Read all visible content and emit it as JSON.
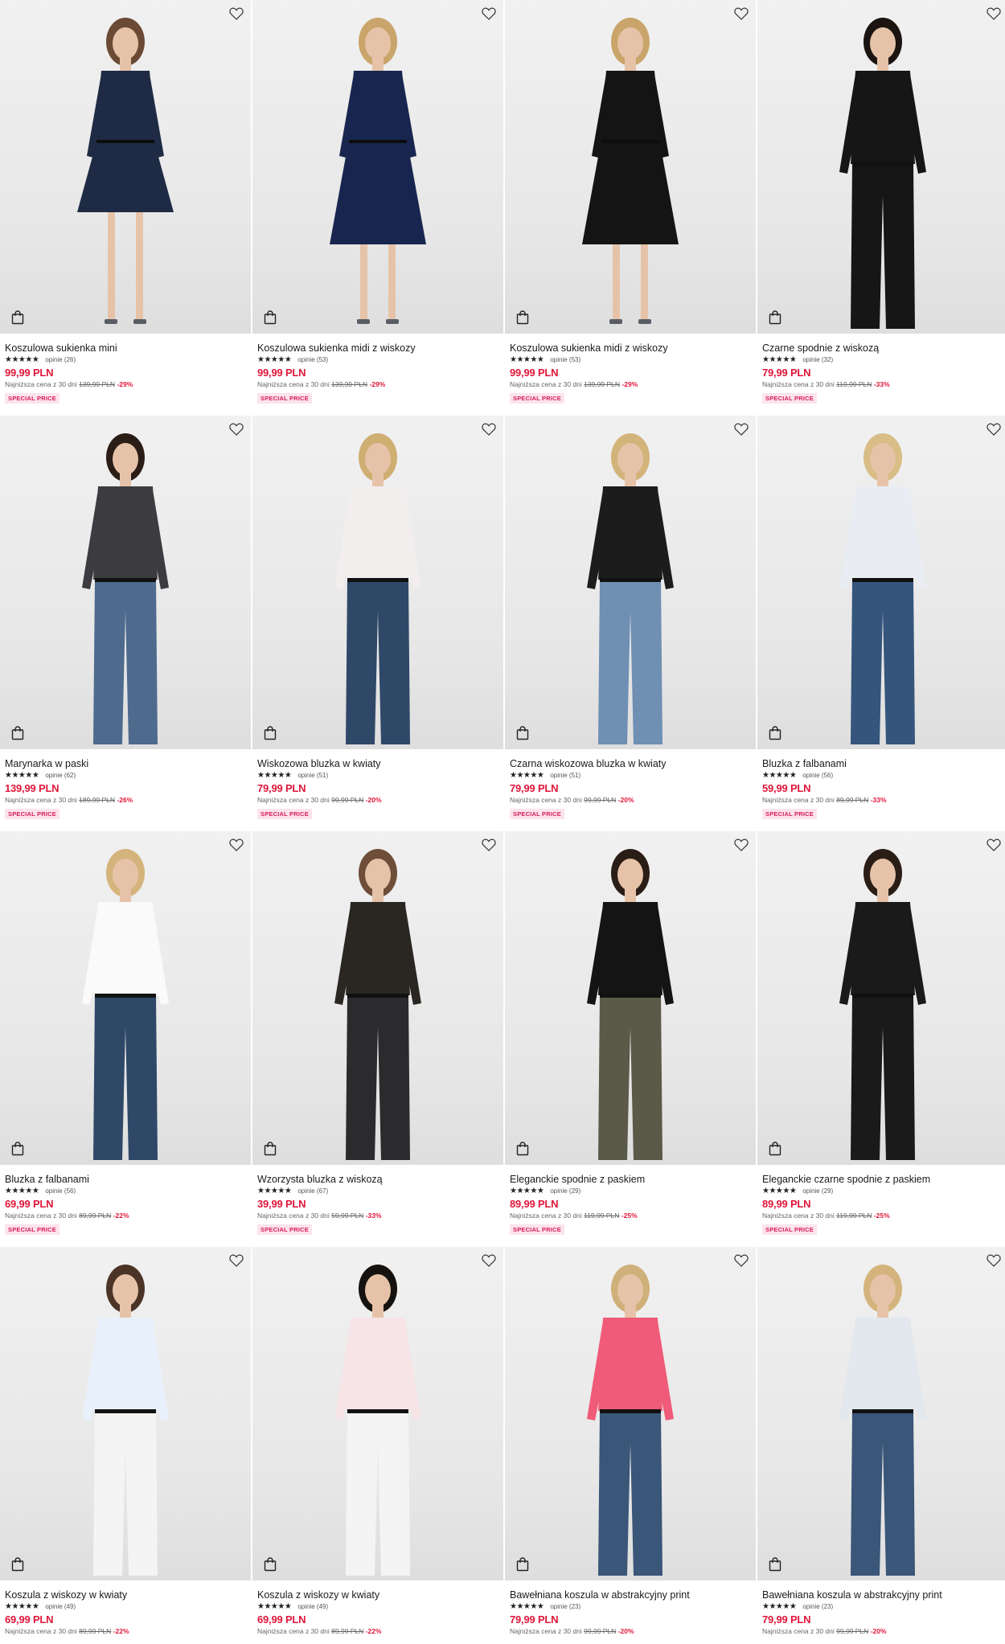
{
  "colors": {
    "price": "#e0163a",
    "badge_text": "#d81b60",
    "badge_bg": "#fce4ec"
  },
  "products": [
    {
      "name": "Koszulowa sukienka mini",
      "reviews": "opinie (26)",
      "price": "99,99 PLN",
      "lowest_label": "Najniższa cena z 30 dni",
      "old_price": "139,99 PLN",
      "discount": "-29%",
      "badge": "SPECIAL PRICE",
      "top": "#1f2b44",
      "bottom": "#1f2b44",
      "length": "mini",
      "hair": "#6b4a35"
    },
    {
      "name": "Koszulowa sukienka midi z wiskozy",
      "reviews": "opinie (53)",
      "price": "99,99 PLN",
      "lowest_label": "Najniższa cena z 30 dni",
      "old_price": "139,99 PLN",
      "discount": "-29%",
      "badge": "SPECIAL PRICE",
      "top": "#18264f",
      "bottom": "#18264f",
      "length": "midi",
      "hair": "#c9a56b"
    },
    {
      "name": "Koszulowa sukienka midi z wiskozy",
      "reviews": "opinie (53)",
      "price": "99,99 PLN",
      "lowest_label": "Najniższa cena z 30 dni",
      "old_price": "139,99 PLN",
      "discount": "-29%",
      "badge": "SPECIAL PRICE",
      "top": "#141414",
      "bottom": "#141414",
      "length": "midi",
      "hair": "#c9a56b"
    },
    {
      "name": "Czarne spodnie z wiskozą",
      "reviews": "opinie (32)",
      "price": "79,99 PLN",
      "lowest_label": "Najniższa cena z 30 dni",
      "old_price": "119,99 PLN",
      "discount": "-33%",
      "badge": "SPECIAL PRICE",
      "top": "#161616",
      "bottom": "#161616",
      "length": "pants",
      "hair": "#1b1410"
    },
    {
      "name": "Marynarka w paski",
      "reviews": "opinie (62)",
      "price": "139,99 PLN",
      "lowest_label": "Najniższa cena z 30 dni",
      "old_price": "189,99 PLN",
      "discount": "-26%",
      "badge": "SPECIAL PRICE",
      "top": "#3b3b40",
      "bottom": "#4e6b8e",
      "length": "pants",
      "hair": "#2a1d16"
    },
    {
      "name": "Wiskozowa bluzka w kwiaty",
      "reviews": "opinie (51)",
      "price": "79,99 PLN",
      "lowest_label": "Najniższa cena z 30 dni",
      "old_price": "99,99 PLN",
      "discount": "-20%",
      "badge": "SPECIAL PRICE",
      "top": "#f3eeee",
      "bottom": "#2f4868",
      "length": "pants",
      "hair": "#cfae72"
    },
    {
      "name": "Czarna wiskozowa bluzka w kwiaty",
      "reviews": "opinie (51)",
      "price": "79,99 PLN",
      "lowest_label": "Najniższa cena z 30 dni",
      "old_price": "99,99 PLN",
      "discount": "-20%",
      "badge": "SPECIAL PRICE",
      "top": "#1c1c1c",
      "bottom": "#6f8fb3",
      "length": "pants",
      "hair": "#d2b37a"
    },
    {
      "name": "Bluzka z falbanami",
      "reviews": "opinie (56)",
      "price": "59,99 PLN",
      "lowest_label": "Najniższa cena z 30 dni",
      "old_price": "89,99 PLN",
      "discount": "-33%",
      "badge": "SPECIAL PRICE",
      "top": "#e9edf3",
      "bottom": "#35557c",
      "length": "pants",
      "hair": "#d8bd86"
    },
    {
      "name": "Bluzka z falbanami",
      "reviews": "opinie (56)",
      "price": "69,99 PLN",
      "lowest_label": "Najniższa cena z 30 dni",
      "old_price": "89,99 PLN",
      "discount": "-22%",
      "badge": "SPECIAL PRICE",
      "top": "#fafafa",
      "bottom": "#2f4868",
      "length": "pants",
      "hair": "#d4b47c"
    },
    {
      "name": "Wzorzysta bluzka z wiskozą",
      "reviews": "opinie (67)",
      "price": "39,99 PLN",
      "lowest_label": "Najniższa cena z 30 dni",
      "old_price": "59,99 PLN",
      "discount": "-33%",
      "badge": "SPECIAL PRICE",
      "top": "#2a2722",
      "bottom": "#2b2b2e",
      "length": "pants",
      "hair": "#6e4e38"
    },
    {
      "name": "Eleganckie spodnie z paskiem",
      "reviews": "opinie (29)",
      "price": "89,99 PLN",
      "lowest_label": "Najniższa cena z 30 dni",
      "old_price": "119,99 PLN",
      "discount": "-25%",
      "badge": "SPECIAL PRICE",
      "top": "#141414",
      "bottom": "#5b5a49",
      "length": "pants",
      "hair": "#2a1d16"
    },
    {
      "name": "Eleganckie czarne spodnie z paskiem",
      "reviews": "opinie (29)",
      "price": "89,99 PLN",
      "lowest_label": "Najniższa cena z 30 dni",
      "old_price": "119,99 PLN",
      "discount": "-25%",
      "badge": "SPECIAL PRICE",
      "top": "#1a1a1a",
      "bottom": "#1a1a1a",
      "length": "pants",
      "hair": "#2a1d16"
    },
    {
      "name": "Koszula z wiskozy w kwiaty",
      "reviews": "opinie (49)",
      "price": "69,99 PLN",
      "lowest_label": "Najniższa cena z 30 dni",
      "old_price": "89,99 PLN",
      "discount": "-22%",
      "badge": "",
      "top": "#e8f1fb",
      "bottom": "#f4f4f4",
      "length": "pants",
      "hair": "#4b3426"
    },
    {
      "name": "Koszula z wiskozy w kwiaty",
      "reviews": "opinie (49)",
      "price": "69,99 PLN",
      "lowest_label": "Najniższa cena z 30 dni",
      "old_price": "89,99 PLN",
      "discount": "-22%",
      "badge": "",
      "top": "#f6e4e7",
      "bottom": "#f4f4f4",
      "length": "pants",
      "hair": "#161210"
    },
    {
      "name": "Bawełniana koszula w abstrakcyjny print",
      "reviews": "opinie (23)",
      "price": "79,99 PLN",
      "lowest_label": "Najniższa cena z 30 dni",
      "old_price": "99,99 PLN",
      "discount": "-20%",
      "badge": "",
      "top": "#ef5b78",
      "bottom": "#3a5678",
      "length": "pants",
      "hair": "#d0b07a"
    },
    {
      "name": "Bawełniana koszula w abstrakcyjny print",
      "reviews": "opinie (23)",
      "price": "79,99 PLN",
      "lowest_label": "Najniższa cena z 30 dni",
      "old_price": "99,99 PLN",
      "discount": "-20%",
      "badge": "",
      "top": "#e3e7ee",
      "bottom": "#3a5678",
      "length": "pants",
      "hair": "#d4b47c"
    }
  ]
}
